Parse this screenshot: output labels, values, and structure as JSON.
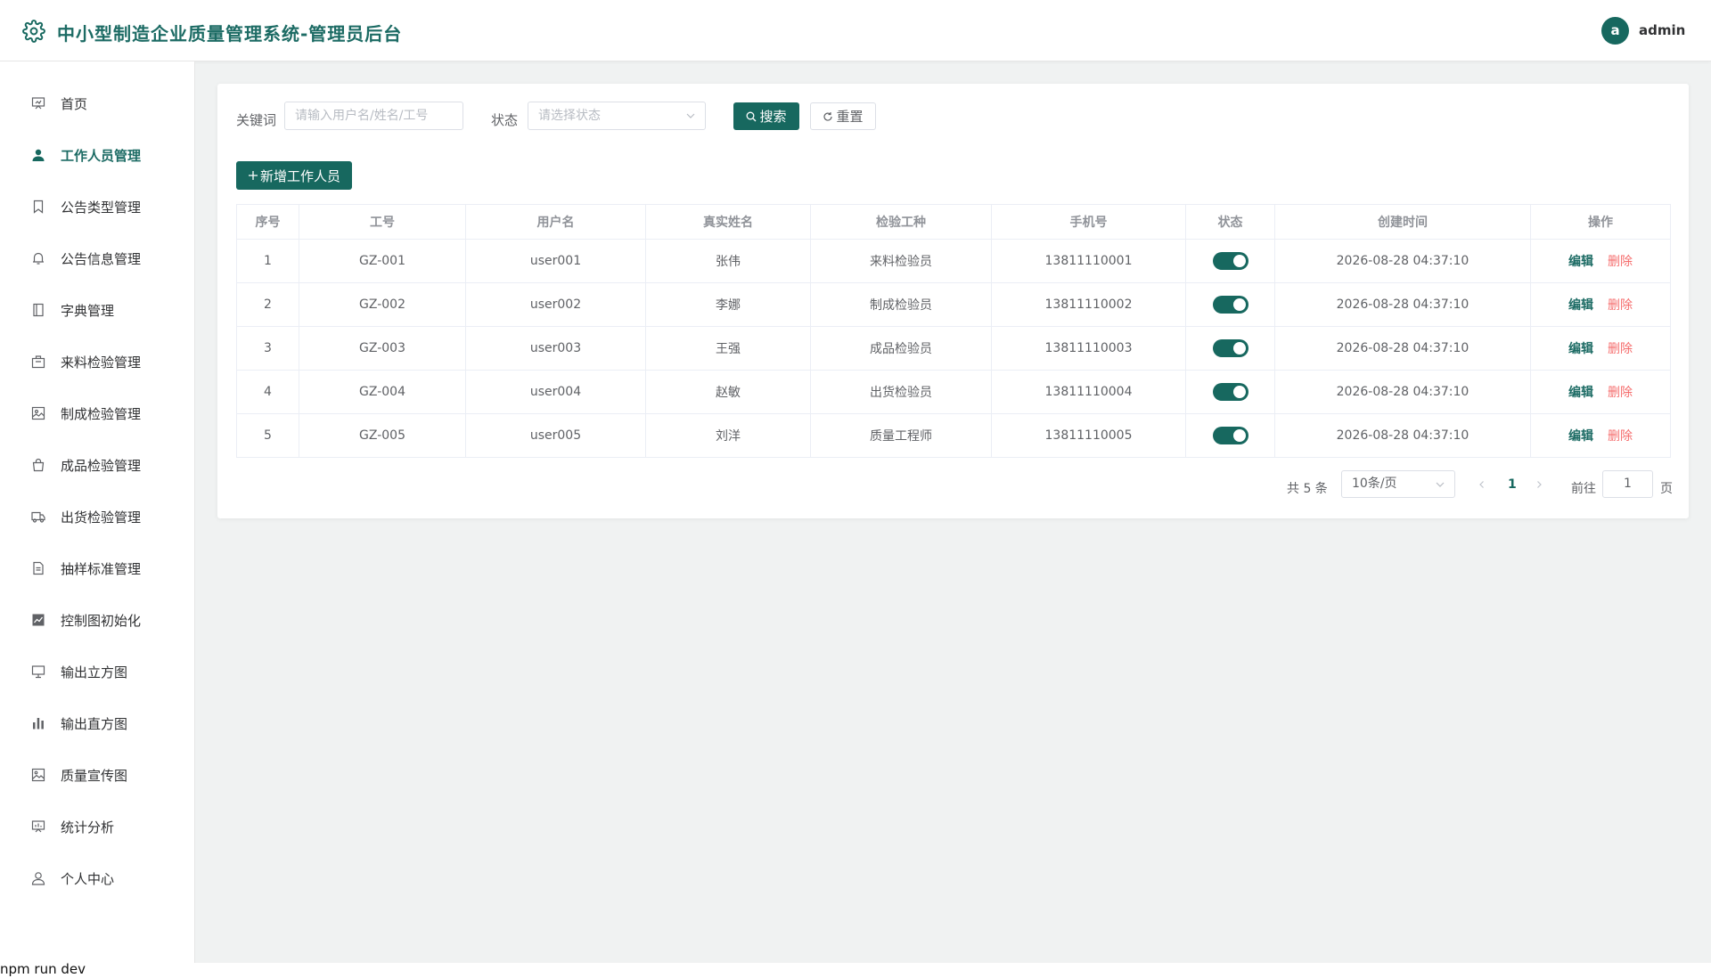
{
  "header": {
    "title": "中小型制造企业质量管理系统-管理员后台",
    "avatar_letter": "a",
    "username": "admin"
  },
  "sidebar": {
    "items": [
      {
        "label": "首页",
        "icon": "dashboard-icon"
      },
      {
        "label": "工作人员管理",
        "icon": "user-filled-icon",
        "active": true
      },
      {
        "label": "公告类型管理",
        "icon": "bookmark-icon"
      },
      {
        "label": "公告信息管理",
        "icon": "bell-icon"
      },
      {
        "label": "字典管理",
        "icon": "notebook-icon"
      },
      {
        "label": "来料检验管理",
        "icon": "briefcase-icon"
      },
      {
        "label": "制成检验管理",
        "icon": "picture-icon"
      },
      {
        "label": "成品检验管理",
        "icon": "handbag-icon"
      },
      {
        "label": "出货检验管理",
        "icon": "truck-icon"
      },
      {
        "label": "抽样标准管理",
        "icon": "document-icon"
      },
      {
        "label": "控制图初始化",
        "icon": "line-chart-icon"
      },
      {
        "label": "输出立方图",
        "icon": "present-icon"
      },
      {
        "label": "输出直方图",
        "icon": "bar-chart-icon"
      },
      {
        "label": "质量宣传图",
        "icon": "image-icon"
      },
      {
        "label": "统计分析",
        "icon": "data-board-icon"
      },
      {
        "label": "个人中心",
        "icon": "user-icon"
      }
    ]
  },
  "filters": {
    "keyword_label": "关键词",
    "keyword_placeholder": "请输入用户名/姓名/工号",
    "status_label": "状态",
    "status_placeholder": "请选择状态",
    "search_label": "搜索",
    "reset_label": "重置",
    "add_label": "新增工作人员"
  },
  "table": {
    "columns": [
      "序号",
      "工号",
      "用户名",
      "真实姓名",
      "检验工种",
      "手机号",
      "状态",
      "创建时间",
      "操作"
    ],
    "rows": [
      {
        "index": "1",
        "code": "GZ-001",
        "username": "user001",
        "realname": "张伟",
        "role": "来料检验员",
        "phone": "13811110001",
        "enabled": true,
        "created": "2026-08-28 04:37:10"
      },
      {
        "index": "2",
        "code": "GZ-002",
        "username": "user002",
        "realname": "李娜",
        "role": "制成检验员",
        "phone": "13811110002",
        "enabled": true,
        "created": "2026-08-28 04:37:10"
      },
      {
        "index": "3",
        "code": "GZ-003",
        "username": "user003",
        "realname": "王强",
        "role": "成品检验员",
        "phone": "13811110003",
        "enabled": true,
        "created": "2026-08-28 04:37:10"
      },
      {
        "index": "4",
        "code": "GZ-004",
        "username": "user004",
        "realname": "赵敏",
        "role": "出货检验员",
        "phone": "13811110004",
        "enabled": true,
        "created": "2026-08-28 04:37:10"
      },
      {
        "index": "5",
        "code": "GZ-005",
        "username": "user005",
        "realname": "刘洋",
        "role": "质量工程师",
        "phone": "13811110005",
        "enabled": true,
        "created": "2026-08-28 04:37:10"
      }
    ],
    "edit_label": "编辑",
    "delete_label": "删除"
  },
  "pagination": {
    "total_text": "共 5 条",
    "page_size": "10条/页",
    "current_page": "1",
    "goto_label": "前往",
    "goto_value": "1",
    "page_suffix": "页"
  },
  "terminal": {
    "text": "npm run dev"
  },
  "colors": {
    "primary": "#17685f",
    "danger": "#f56c6c",
    "background": "#f0f2f2"
  }
}
